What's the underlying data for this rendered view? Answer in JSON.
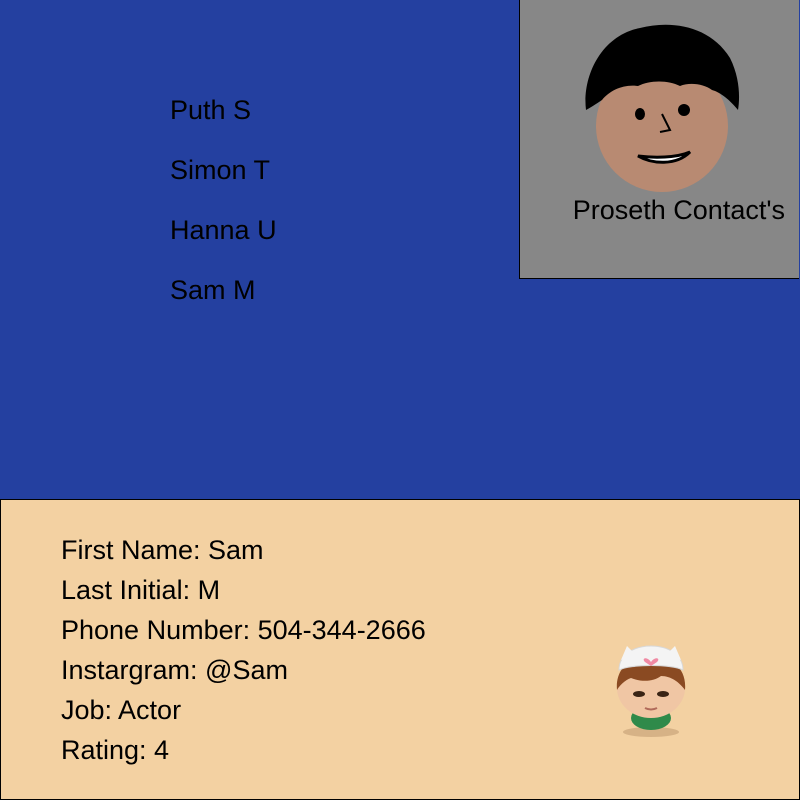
{
  "contacts": [
    {
      "label": "Puth S"
    },
    {
      "label": "Simon T"
    },
    {
      "label": "Hanna U"
    },
    {
      "label": "Sam M"
    }
  ],
  "profile": {
    "title": "Proseth Contact's",
    "icon": "cartoon-face-icon"
  },
  "details": {
    "first_name": "First Name: Sam",
    "last_initial": "Last Initial: M",
    "phone": "Phone Number: 504-344-2666",
    "instagram": "Instargram: @Sam",
    "job": "Job: Actor",
    "rating": "Rating: 4",
    "avatar_icon": "doll-avatar-icon"
  },
  "colors": {
    "top_background": "#2440a0",
    "profile_background": "#878787",
    "detail_background": "#f3d1a2",
    "face_skin": "#b88a72"
  }
}
